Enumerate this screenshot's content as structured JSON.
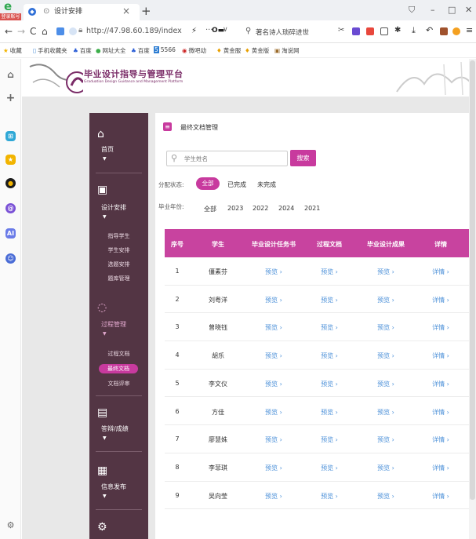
{
  "browser": {
    "badge_text": "登录账号",
    "tab_title": "设计安排",
    "url": "http://47.98.60.189/index",
    "search_text": "著名诗人琐碎进世",
    "bookmarks": [
      "收藏",
      "手机收藏夹",
      "百度",
      "网址大全",
      "百度",
      "5566",
      "微吧动",
      "黄金服",
      "黄金版",
      "淘说网"
    ]
  },
  "site": {
    "title": "毕业设计指导与管理平台",
    "subtitle": "Graduation Design Guidance and Management Platform"
  },
  "menu": {
    "sections": [
      {
        "label": "首页"
      },
      {
        "label": "设计安排",
        "items": [
          "指导学生",
          "学生安排",
          "选题安排",
          "题库管理"
        ]
      },
      {
        "label": "过程管理",
        "items": [
          "过程文档",
          "最终文档",
          "文档评审"
        ]
      },
      {
        "label": "答辩/成绩"
      },
      {
        "label": "信息发布"
      }
    ],
    "active_item": "最终文档"
  },
  "content": {
    "title": "最终文档管理",
    "search_placeholder": "学生姓名",
    "search_button": "搜索",
    "status_label": "分配状态:",
    "status_options": [
      "全部",
      "已完成",
      "未完成"
    ],
    "year_label": "毕业年份:",
    "year_options": [
      "全部",
      "2023",
      "2022",
      "2024",
      "2021"
    ],
    "columns": [
      "序号",
      "学生",
      "毕业设计任务书",
      "过程文档",
      "毕业设计成果",
      "详情"
    ],
    "preview_text": "预览 ›",
    "detail_text": "详情 ›",
    "rows": [
      {
        "no": "1",
        "name": "僵素芬"
      },
      {
        "no": "2",
        "name": "刘粤洋"
      },
      {
        "no": "3",
        "name": "曾晓钰"
      },
      {
        "no": "4",
        "name": "胡乐"
      },
      {
        "no": "5",
        "name": "李文仪"
      },
      {
        "no": "6",
        "name": "方佳"
      },
      {
        "no": "7",
        "name": "廖慧姝"
      },
      {
        "no": "8",
        "name": "李菲琪"
      },
      {
        "no": "9",
        "name": "吴向莹"
      }
    ]
  },
  "colors": {
    "accent": "#c83a9e",
    "menu_bg": "#533544",
    "link": "#4a8fd8"
  }
}
